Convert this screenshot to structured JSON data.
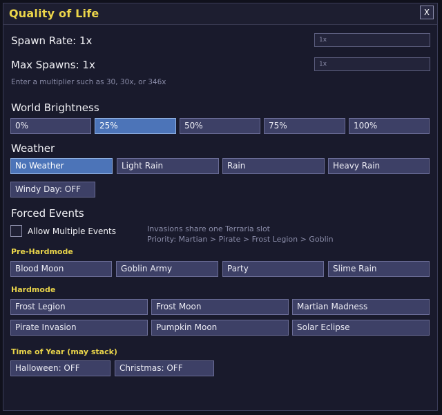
{
  "window": {
    "title": "Quality of Life",
    "close_label": "X"
  },
  "spawn": {
    "rate_label": "Spawn Rate: 1x",
    "rate_value": "1x",
    "max_label": "Max Spawns: 1x",
    "max_value": "1x",
    "hint": "Enter a multiplier such as 30, 30x, or 346x"
  },
  "brightness": {
    "title": "World Brightness",
    "options": [
      "0%",
      "25%",
      "50%",
      "75%",
      "100%"
    ],
    "selected": "25%"
  },
  "weather": {
    "title": "Weather",
    "options": [
      "No Weather",
      "Light Rain",
      "Rain",
      "Heavy Rain"
    ],
    "selected": "No Weather",
    "windy_label": "Windy Day: OFF"
  },
  "events": {
    "title": "Forced Events",
    "allow_multiple_label": "Allow Multiple Events",
    "allow_multiple_checked": false,
    "info_line1": "Invasions share one Terraria slot",
    "info_line2": "Priority: Martian > Pirate > Frost Legion > Goblin",
    "prehardmode_title": "Pre-Hardmode",
    "prehardmode": [
      "Blood Moon",
      "Goblin Army",
      "Party",
      "Slime Rain"
    ],
    "hardmode_title": "Hardmode",
    "hardmode": [
      "Frost Legion",
      "Frost Moon",
      "Martian Madness",
      "Pirate Invasion",
      "Pumpkin Moon",
      "Solar Eclipse"
    ],
    "time_of_year_title": "Time of Year (may stack)",
    "time_of_year": [
      "Halloween: OFF",
      "Christmas: OFF"
    ]
  },
  "colors": {
    "title_yellow": "#ecd64a",
    "panel_bg": "#191a2c",
    "button_bg": "#3d4066",
    "button_active": "#4c74b8"
  }
}
